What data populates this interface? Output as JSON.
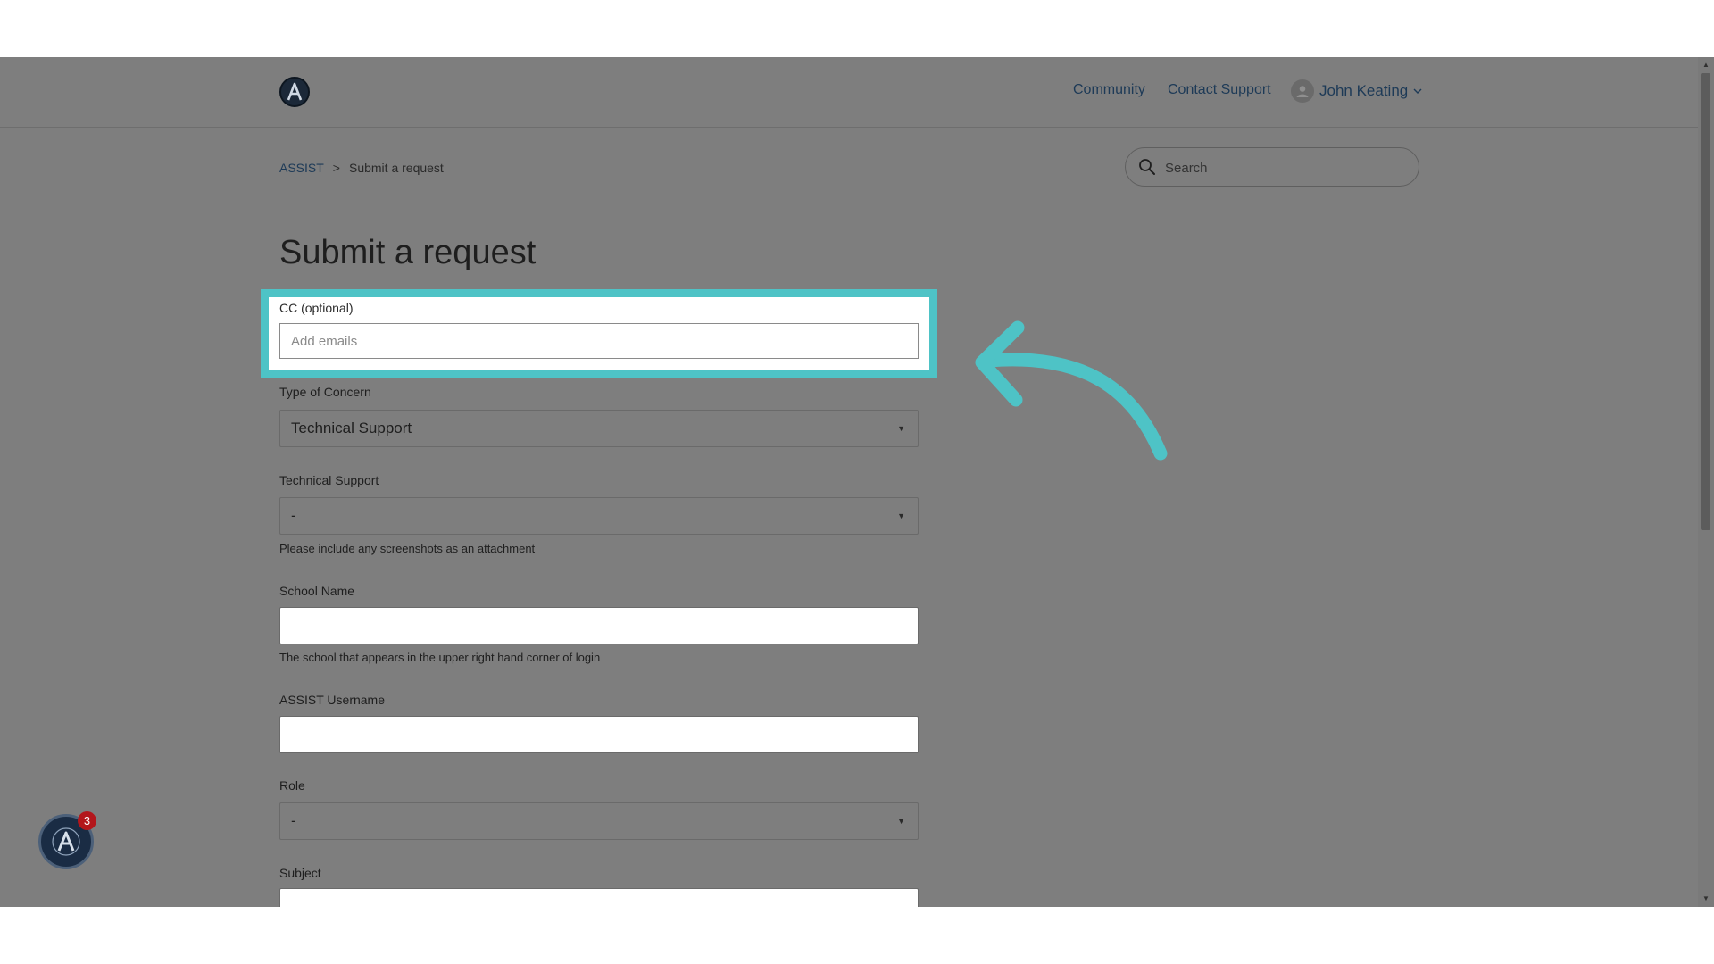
{
  "header": {
    "nav": {
      "community": "Community",
      "contact_support": "Contact Support"
    },
    "user": {
      "name": "John Keating",
      "icon": "user-avatar-icon"
    },
    "logo_icon": "assist-logo-icon"
  },
  "breadcrumb": {
    "home": "ASSIST",
    "separator": ">",
    "current": "Submit a request"
  },
  "search": {
    "placeholder": "Search",
    "icon": "search-icon"
  },
  "page": {
    "title": "Submit a request"
  },
  "form": {
    "cc": {
      "label": "CC (optional)",
      "placeholder": "Add emails"
    },
    "type_of_concern": {
      "label": "Type of Concern",
      "value": "Technical Support"
    },
    "technical_support": {
      "label": "Technical Support",
      "value": "-",
      "hint": "Please include any screenshots as an attachment"
    },
    "school_name": {
      "label": "School Name",
      "value": "",
      "hint": "The school that appears in the upper right hand corner of login"
    },
    "assist_username": {
      "label": "ASSIST Username",
      "value": ""
    },
    "role": {
      "label": "Role",
      "value": "-"
    },
    "subject": {
      "label": "Subject",
      "value": ""
    }
  },
  "widget": {
    "badge_count": "3"
  },
  "colors": {
    "highlight": "#4ec3c6",
    "overlay": "#7e7e7e",
    "badge": "#b3161b"
  }
}
